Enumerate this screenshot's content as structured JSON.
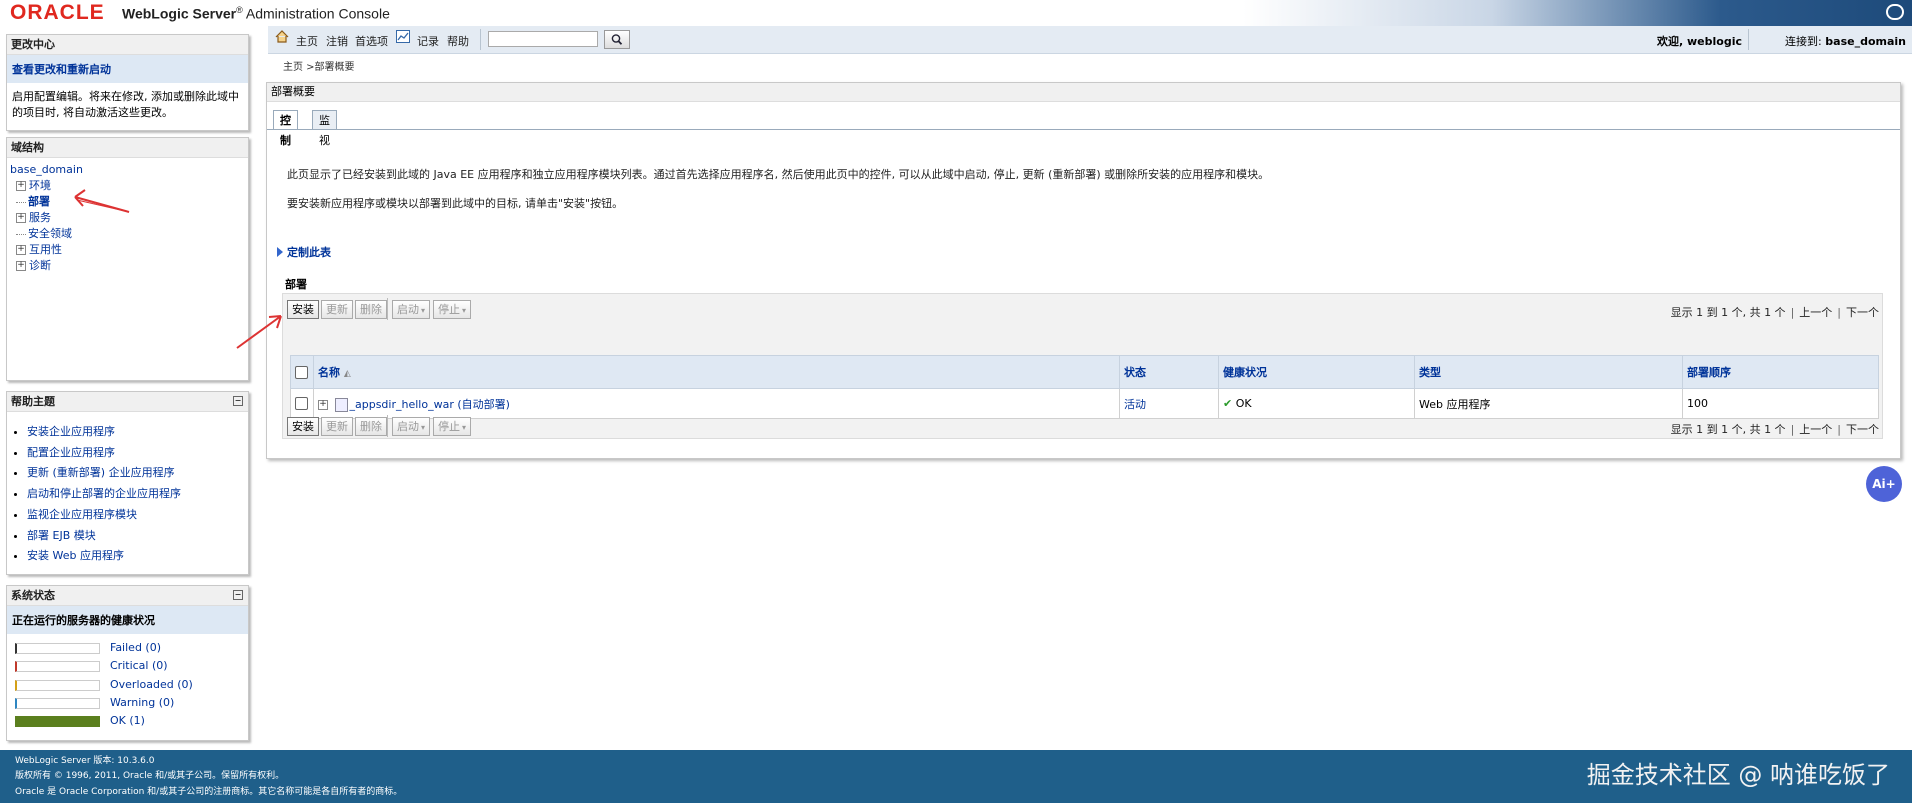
{
  "header": {
    "brand": "ORACLE",
    "product": "WebLogic Server",
    "reg": "®",
    "console": "Administration Console"
  },
  "change_center": {
    "title": "更改中心",
    "link": "查看更改和重新启动",
    "text": "启用配置编辑。将来在修改, 添加或删除此域中的项目时, 将自动激活这些更改。"
  },
  "domain_structure": {
    "title": "域结构",
    "root": "base_domain",
    "items": [
      {
        "label": "环境",
        "expand": "+"
      },
      {
        "label": "部署",
        "expand": ""
      },
      {
        "label": "服务",
        "expand": "+"
      },
      {
        "label": "安全领域",
        "expand": ""
      },
      {
        "label": "互用性",
        "expand": "+"
      },
      {
        "label": "诊断",
        "expand": "+"
      }
    ]
  },
  "help_topics": {
    "title": "帮助主题",
    "collapse": "−",
    "items": [
      "安装企业应用程序",
      "配置企业应用程序",
      "更新 (重新部署) 企业应用程序",
      "启动和停止部署的企业应用程序",
      "监视企业应用程序模块",
      "部署 EJB 模块",
      "安装 Web 应用程序"
    ]
  },
  "system_status": {
    "title": "系统状态",
    "collapse": "−",
    "subtitle": "正在运行的服务器的健康状况",
    "rows": [
      {
        "label": "Failed (0)",
        "color": "#333333",
        "fill": 0
      },
      {
        "label": "Critical (0)",
        "color": "#c0392b",
        "fill": 0
      },
      {
        "label": "Overloaded (0)",
        "color": "#d4a017",
        "fill": 0
      },
      {
        "label": "Warning (0)",
        "color": "#2e86c1",
        "fill": 0
      },
      {
        "label": "OK (1)",
        "color": "#5b7f1e",
        "fill": 1
      }
    ]
  },
  "toolbar": {
    "home": "主页",
    "logout": "注销",
    "preferences": "首选项",
    "record": "记录",
    "help": "帮助",
    "search_value": "",
    "welcome": "欢迎, weblogic",
    "connected_label": "连接到:",
    "connected_domain": "base_domain"
  },
  "breadcrumb": "主页 >部署概要",
  "main": {
    "title": "部署概要",
    "tabs": [
      "控制",
      "监视"
    ],
    "desc1": "此页显示了已经安装到此域的 Java EE 应用程序和独立应用程序模块列表。通过首先选择应用程序名, 然后使用此页中的控件, 可以从此域中启动, 停止, 更新 (重新部署) 或删除所安装的应用程序和模块。",
    "desc2": "要安装新应用程序或模块以部署到此域中的目标, 请单击\"安装\"按钮。",
    "customize": "定制此表",
    "section": "部署",
    "buttons": {
      "install": "安装",
      "update": "更新",
      "delete": "删除",
      "start": "启动",
      "stop": "停止"
    },
    "pager": {
      "text": "显示 1 到 1 个, 共 1 个",
      "prev": "上一个",
      "next": "下一个"
    },
    "columns": [
      "名称",
      "状态",
      "健康状况",
      "类型",
      "部署顺序"
    ],
    "rows": [
      {
        "name": "_appsdir_hello_war (自动部署)",
        "state": "活动",
        "health": "OK",
        "type": "Web 应用程序",
        "order": "100"
      }
    ]
  },
  "footer": {
    "version": "WebLogic Server 版本: 10.3.6.0",
    "copyright": "版权所有 © 1996, 2011, Oracle 和/或其子公司。保留所有权利。",
    "trademark": "Oracle 是 Oracle Corporation 和/或其子公司的注册商标。其它名称可能是各自所有者的商标。",
    "watermark": "掘金技术社区 @ 呐谁吃饭了"
  },
  "ai_button": "Ai+"
}
